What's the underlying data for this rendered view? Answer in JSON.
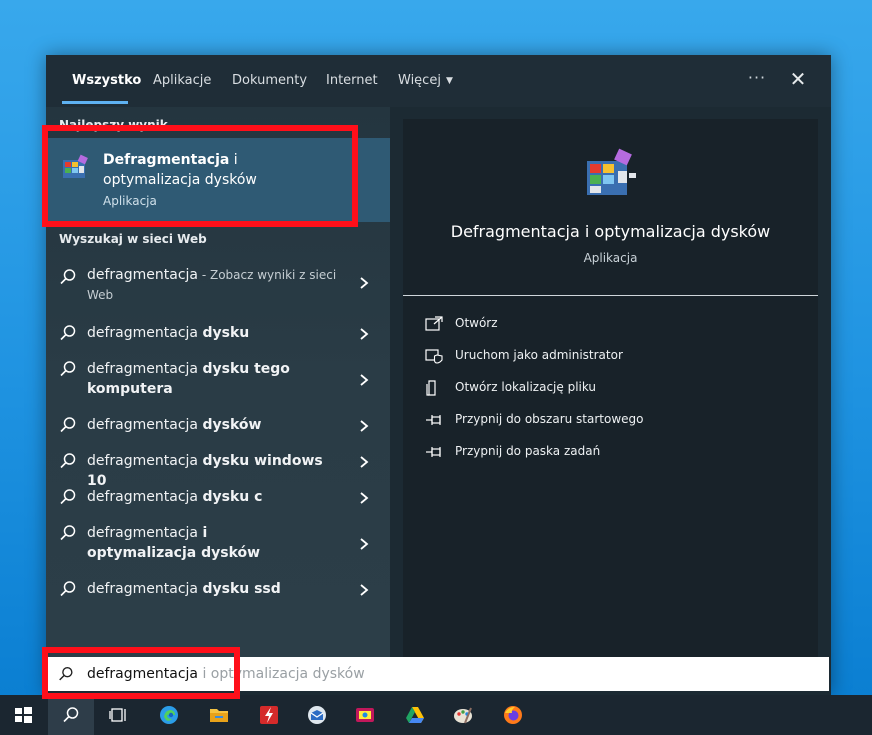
{
  "tabs": [
    {
      "label": "Wszystko",
      "active": true
    },
    {
      "label": "Aplikacje"
    },
    {
      "label": "Dokumenty"
    },
    {
      "label": "Internet"
    },
    {
      "label": "Więcej"
    }
  ],
  "best_match": {
    "section": "Najlepszy wynik",
    "title_bold": "Defragmentacja",
    "title_rest": " i optymalizacja dysków",
    "subtitle": "Aplikacja"
  },
  "web_section": "Wyszukaj w sieci Web",
  "web_results": [
    {
      "normal": "defragmentacja",
      "bold": "",
      "suffix": " - Zobacz wyniki z sieci Web"
    },
    {
      "normal": "defragmentacja ",
      "bold": "dysku"
    },
    {
      "normal": "defragmentacja ",
      "bold": "dysku tego komputera"
    },
    {
      "normal": "defragmentacja ",
      "bold": "dysków"
    },
    {
      "normal": "defragmentacja ",
      "bold": "dysku windows 10"
    },
    {
      "normal": "defragmentacja ",
      "bold": "dysku c"
    },
    {
      "normal": "defragmentacja ",
      "bold": "i optymalizacja dysków"
    },
    {
      "normal": "defragmentacja ",
      "bold": "dysku ssd"
    }
  ],
  "preview": {
    "title": "Defragmentacja i optymalizacja dysków",
    "subtitle": "Aplikacja",
    "actions": [
      {
        "label": "Otwórz",
        "icon": "open-icon"
      },
      {
        "label": "Uruchom jako administrator",
        "icon": "shield-icon"
      },
      {
        "label": "Otwórz lokalizację pliku",
        "icon": "file-location-icon"
      },
      {
        "label": "Przypnij do obszaru startowego",
        "icon": "pin-icon"
      },
      {
        "label": "Przypnij do paska zadań",
        "icon": "pin-icon"
      }
    ]
  },
  "search": {
    "typed": "defragmentacja",
    "hint": " i optymalizacja dysków"
  },
  "taskbar": [
    "start",
    "search",
    "task-view",
    "edge",
    "file-explorer",
    "flash-app",
    "mail-app",
    "media-app",
    "google-drive",
    "paint",
    "firefox"
  ]
}
